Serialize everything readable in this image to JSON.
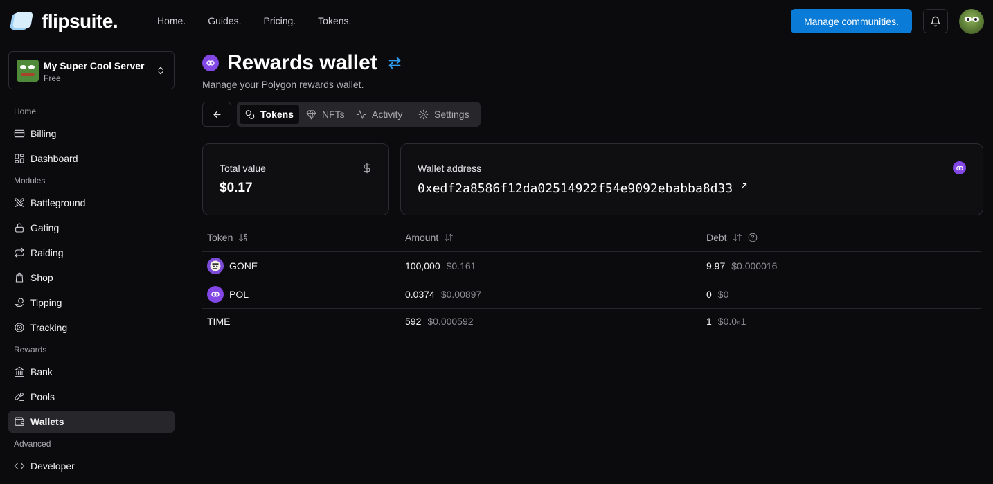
{
  "brand": {
    "name": "flipsuite."
  },
  "nav": {
    "items": [
      "Home.",
      "Guides.",
      "Pricing.",
      "Tokens."
    ]
  },
  "header": {
    "manage_label": "Manage communities."
  },
  "server": {
    "name": "My Super Cool Server",
    "plan": "Free"
  },
  "sidebar": {
    "sections": [
      "Home",
      "Modules",
      "Rewards",
      "Advanced"
    ],
    "items": [
      "Billing",
      "Dashboard",
      "Battleground",
      "Gating",
      "Raiding",
      "Shop",
      "Tipping",
      "Tracking",
      "Bank",
      "Pools",
      "Wallets",
      "Developer"
    ],
    "active": "Wallets"
  },
  "page": {
    "title": "Rewards wallet",
    "subtitle": "Manage your Polygon rewards wallet."
  },
  "tabs": [
    "Tokens",
    "NFTs",
    "Activity",
    "Settings"
  ],
  "active_tab": "Tokens",
  "cards": {
    "total": {
      "label": "Total value",
      "value": "$0.17"
    },
    "wallet": {
      "label": "Wallet address",
      "address": "0xedf2a8586f12da02514922f54e9092ebabba8d33"
    }
  },
  "table": {
    "headers": [
      "Token",
      "Amount",
      "Debt"
    ],
    "rows": [
      {
        "token": "GONE",
        "amount": "100,000",
        "amount_usd": "$0.161",
        "debt": "9.97",
        "debt_usd": "$0.000016"
      },
      {
        "token": "POL",
        "amount": "0.0374",
        "amount_usd": "$0.00897",
        "debt": "0",
        "debt_usd": "$0"
      },
      {
        "token": "TIME",
        "amount": "592",
        "amount_usd": "$0.000592",
        "debt": "1",
        "debt_usd": "$0.0₅1"
      }
    ]
  },
  "colors": {
    "accent": "#0a7bd6",
    "polygon": "#8247e5",
    "background": "#0b0b0d"
  }
}
